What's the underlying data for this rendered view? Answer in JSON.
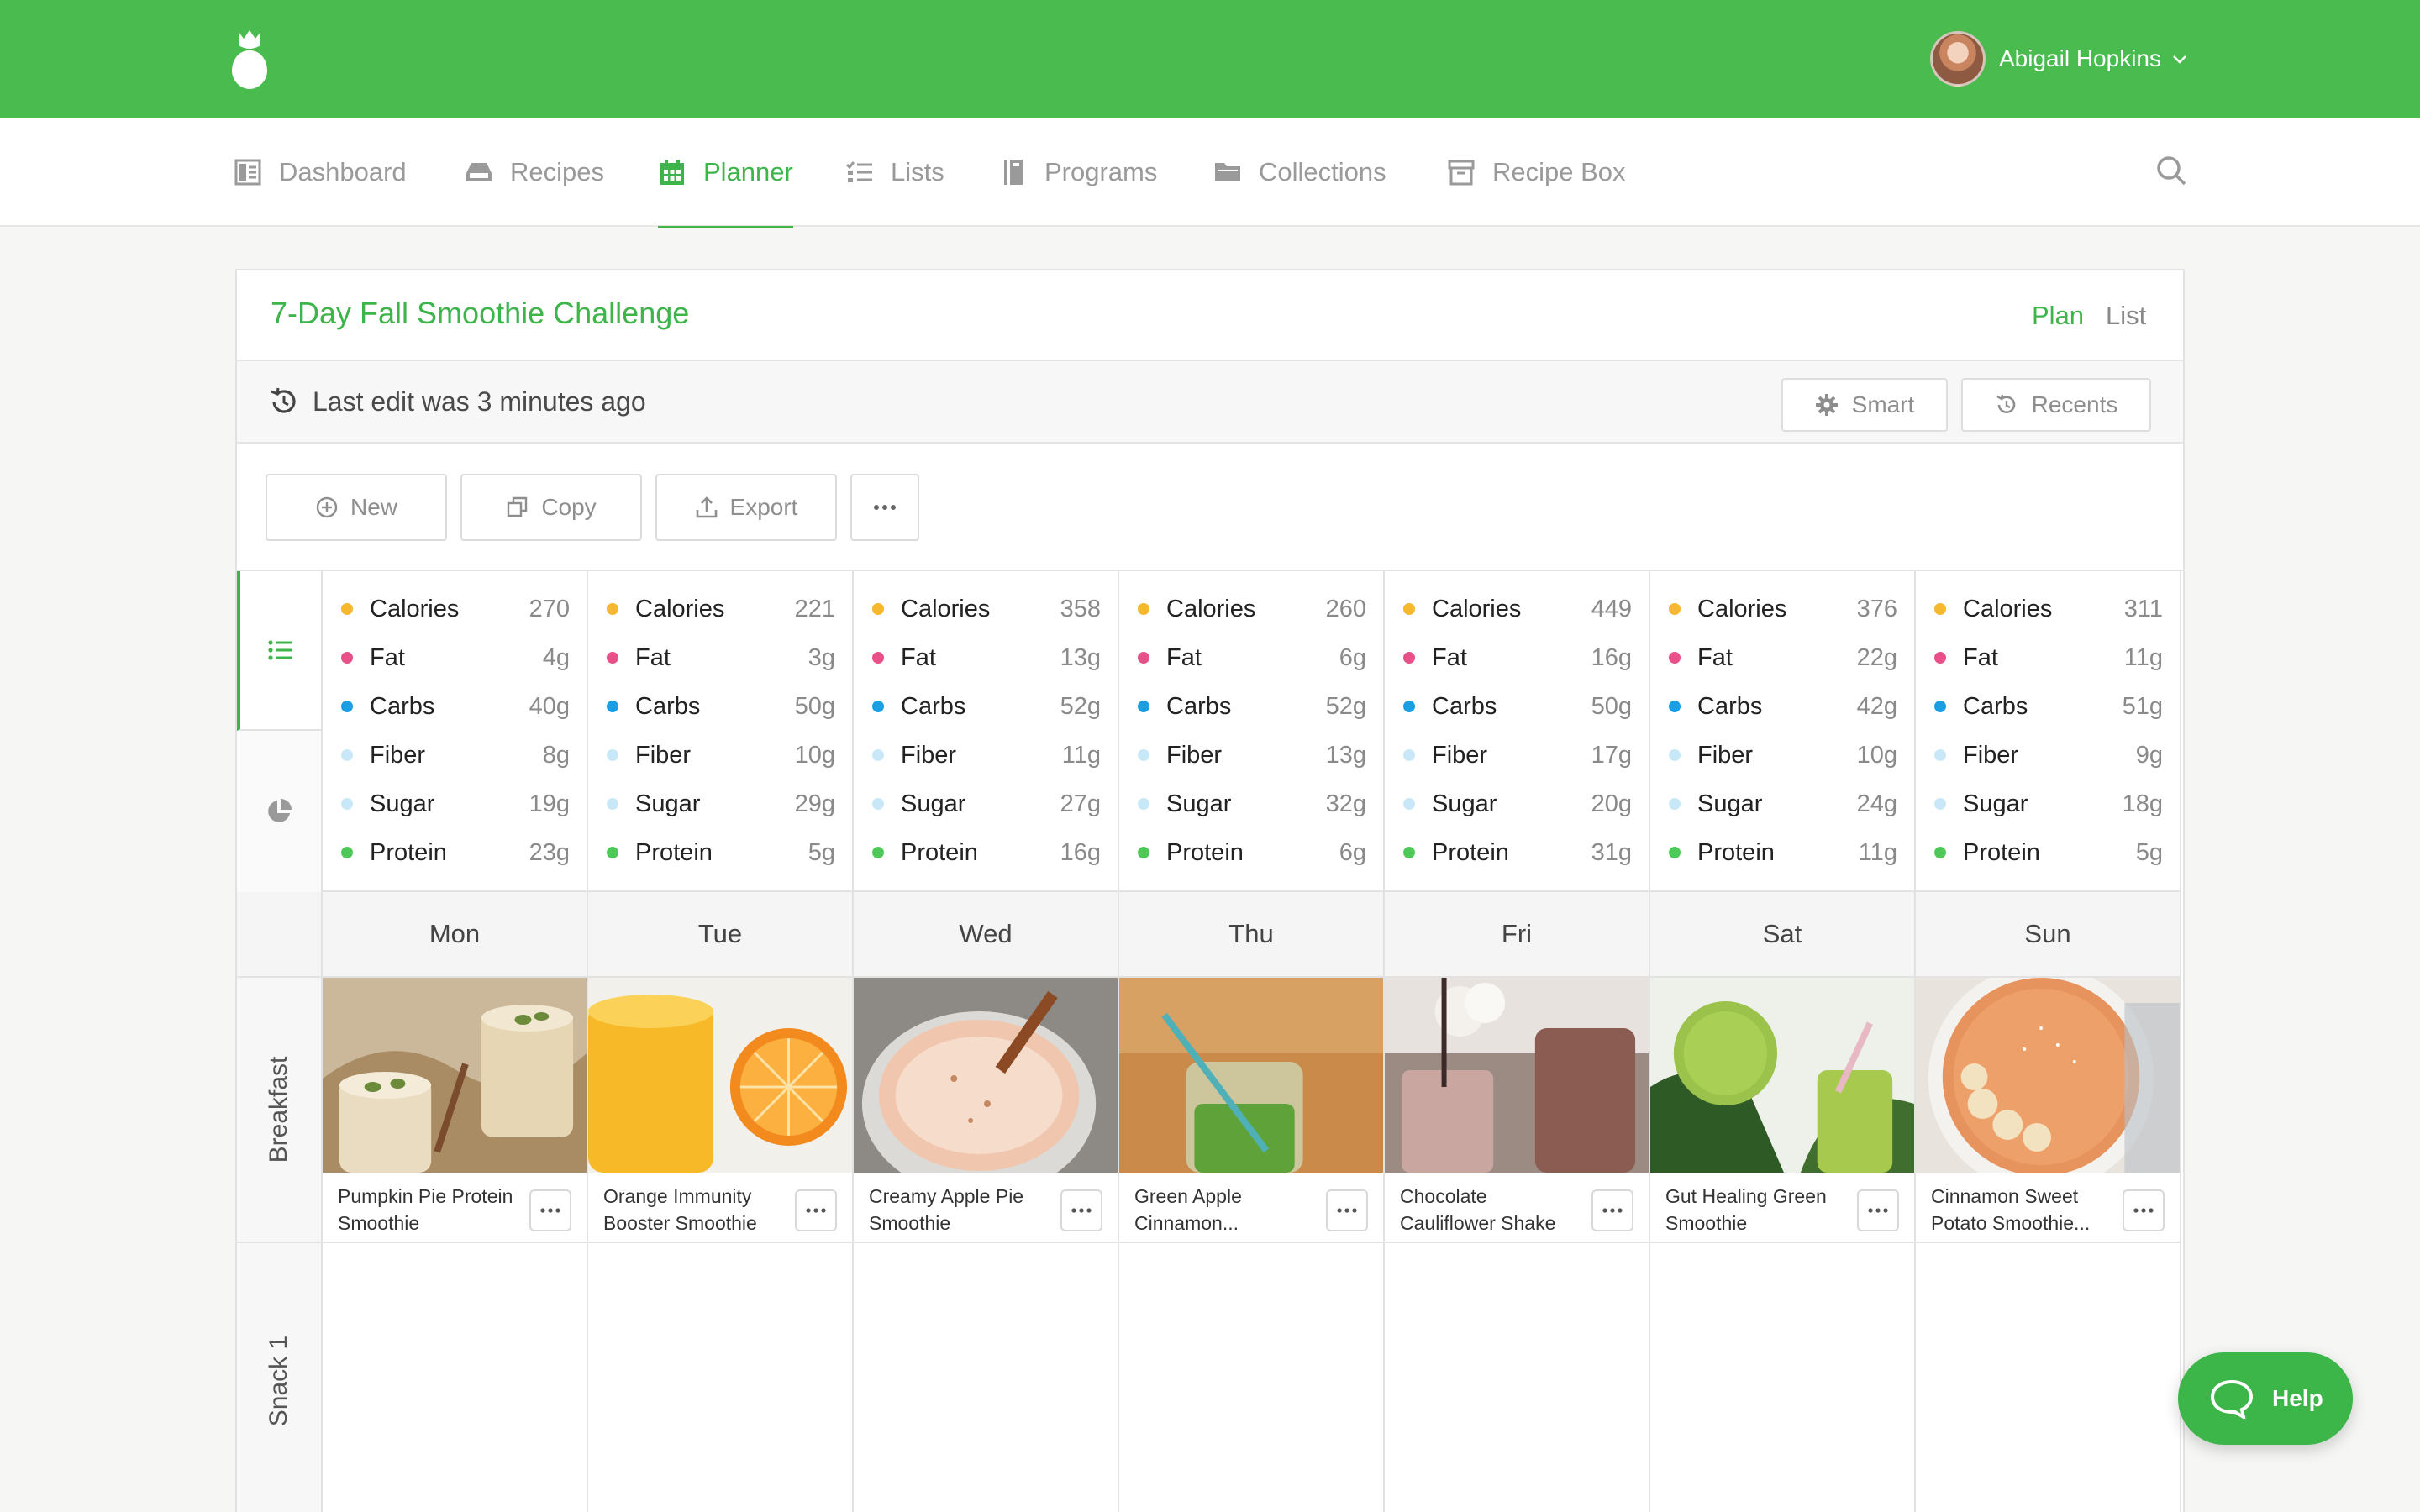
{
  "user": {
    "name": "Abigail Hopkins"
  },
  "nav": {
    "items": [
      {
        "label": "Dashboard",
        "icon": "dashboard-icon",
        "active": false
      },
      {
        "label": "Recipes",
        "icon": "recipes-icon",
        "active": false
      },
      {
        "label": "Planner",
        "icon": "calendar-icon",
        "active": true
      },
      {
        "label": "Lists",
        "icon": "checklist-icon",
        "active": false
      },
      {
        "label": "Programs",
        "icon": "book-icon",
        "active": false
      },
      {
        "label": "Collections",
        "icon": "folder-icon",
        "active": false
      },
      {
        "label": "Recipe Box",
        "icon": "box-icon",
        "active": false
      }
    ]
  },
  "plan": {
    "title": "7-Day Fall Smoothie Challenge",
    "tabs": [
      "Plan",
      "List"
    ],
    "last_edit": "Last edit was 3 minutes ago",
    "smart_label": "Smart",
    "recents_label": "Recents",
    "actions": {
      "new": "New",
      "copy": "Copy",
      "export": "Export"
    }
  },
  "nutrients": [
    {
      "label": "Calories",
      "color": "#f5b82e"
    },
    {
      "label": "Fat",
      "color": "#e8508a"
    },
    {
      "label": "Carbs",
      "color": "#1b9fe2"
    },
    {
      "label": "Fiber",
      "color": "#c9e8f7"
    },
    {
      "label": "Sugar",
      "color": "#c9e8f7"
    },
    {
      "label": "Protein",
      "color": "#4fc85a"
    }
  ],
  "days": [
    {
      "day": "Mon",
      "values": [
        "270",
        "4g",
        "40g",
        "8g",
        "19g",
        "23g"
      ],
      "breakfast": {
        "name": "Pumpkin Pie Protein Smoothie"
      }
    },
    {
      "day": "Tue",
      "values": [
        "221",
        "3g",
        "50g",
        "10g",
        "29g",
        "5g"
      ],
      "breakfast": {
        "name": "Orange Immunity Booster Smoothie"
      }
    },
    {
      "day": "Wed",
      "values": [
        "358",
        "13g",
        "52g",
        "11g",
        "27g",
        "16g"
      ],
      "breakfast": {
        "name": "Creamy Apple Pie Smoothie"
      }
    },
    {
      "day": "Thu",
      "values": [
        "260",
        "6g",
        "52g",
        "13g",
        "32g",
        "6g"
      ],
      "breakfast": {
        "name": "Green Apple Cinnamon..."
      }
    },
    {
      "day": "Fri",
      "values": [
        "449",
        "16g",
        "50g",
        "17g",
        "20g",
        "31g"
      ],
      "breakfast": {
        "name": "Chocolate Cauliflower Shake"
      }
    },
    {
      "day": "Sat",
      "values": [
        "376",
        "22g",
        "42g",
        "10g",
        "24g",
        "11g"
      ],
      "breakfast": {
        "name": "Gut Healing Green Smoothie"
      }
    },
    {
      "day": "Sun",
      "values": [
        "311",
        "11g",
        "51g",
        "9g",
        "18g",
        "5g"
      ],
      "breakfast": {
        "name": "Cinnamon Sweet Potato Smoothie..."
      }
    }
  ],
  "meals": [
    "Breakfast",
    "Snack 1"
  ],
  "help_label": "Help",
  "colors": {
    "brand": "#4abc4f",
    "accent": "#3db54a"
  }
}
